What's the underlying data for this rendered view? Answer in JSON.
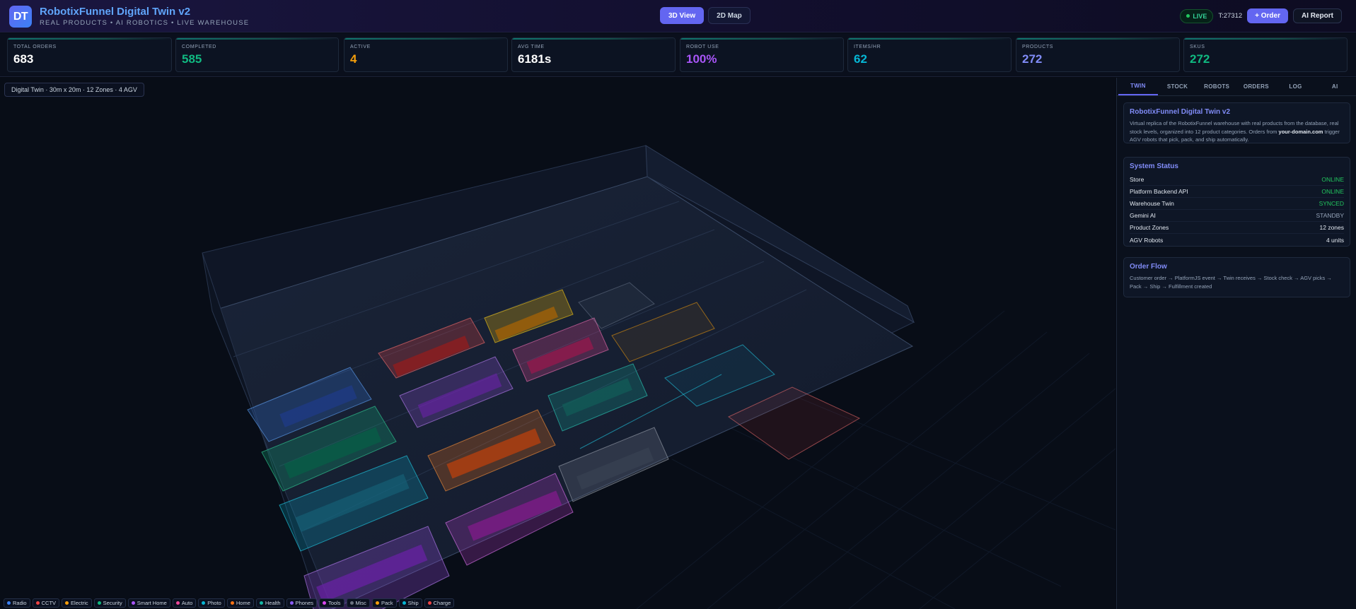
{
  "header": {
    "logo_text": "DT",
    "title": "RobotixFunnel Digital Twin v2",
    "subtitle": "REAL PRODUCTS • AI ROBOTICS • LIVE WAREHOUSE",
    "views": [
      {
        "label": "3D View",
        "active": true
      },
      {
        "label": "2D Map",
        "active": false
      }
    ],
    "live_label": "LIVE",
    "tick": "T:27312",
    "order_button": "+ Order",
    "report_button": "AI Report"
  },
  "stats": [
    {
      "label": "TOTAL ORDERS",
      "value": "683",
      "color": "#ffffff"
    },
    {
      "label": "COMPLETED",
      "value": "585",
      "color": "#10b981"
    },
    {
      "label": "ACTIVE",
      "value": "4",
      "color": "#f59e0b"
    },
    {
      "label": "AVG TIME",
      "value": "6181s",
      "color": "#ffffff"
    },
    {
      "label": "ROBOT USE",
      "value": "100%",
      "color": "#a855f7"
    },
    {
      "label": "ITEMS/HR",
      "value": "62",
      "color": "#06b6d4"
    },
    {
      "label": "PRODUCTS",
      "value": "272",
      "color": "#818cf8"
    },
    {
      "label": "SKUS",
      "value": "272",
      "color": "#10b981"
    }
  ],
  "scene": {
    "label": "Digital Twin · 30m x 20m · 12 Zones · 4 AGV"
  },
  "legend": [
    {
      "label": "Radio",
      "color": "#3b82f6"
    },
    {
      "label": "CCTV",
      "color": "#ef4444"
    },
    {
      "label": "Electric",
      "color": "#f59e0b"
    },
    {
      "label": "Security",
      "color": "#10b981"
    },
    {
      "label": "Smart Home",
      "color": "#a855f7"
    },
    {
      "label": "Auto",
      "color": "#ec4899"
    },
    {
      "label": "Photo",
      "color": "#06b6d4"
    },
    {
      "label": "Home",
      "color": "#f97316"
    },
    {
      "label": "Health",
      "color": "#14b8a6"
    },
    {
      "label": "Phones",
      "color": "#8b5cf6"
    },
    {
      "label": "Tools",
      "color": "#d946ef"
    },
    {
      "label": "Misc",
      "color": "#6b7280"
    },
    {
      "label": "Pack",
      "color": "#f59e0b"
    },
    {
      "label": "Ship",
      "color": "#06b6d4"
    },
    {
      "label": "Charge",
      "color": "#ef4444"
    }
  ],
  "panel": {
    "tabs": [
      {
        "label": "TWIN",
        "active": true
      },
      {
        "label": "STOCK",
        "active": false
      },
      {
        "label": "ROBOTS",
        "active": false
      },
      {
        "label": "ORDERS",
        "active": false
      },
      {
        "label": "LOG",
        "active": false
      },
      {
        "label": "AI",
        "active": false
      }
    ],
    "about": {
      "title": "RobotixFunnel Digital Twin v2",
      "text_before": "Virtual replica of the RobotixFunnel warehouse with real products from the database, real stock levels, organized into 12 product categories. Orders from ",
      "text_bold": "your-domain.com",
      "text_after": " trigger AGV robots that pick, pack, and ship automatically."
    },
    "status": {
      "title": "System Status",
      "rows": [
        {
          "key": "Store",
          "value": "ONLINE",
          "tone": "ok"
        },
        {
          "key": "Platform Backend API",
          "value": "ONLINE",
          "tone": "ok"
        },
        {
          "key": "Warehouse Twin",
          "value": "SYNCED",
          "tone": "ok"
        },
        {
          "key": "Gemini AI",
          "value": "STANDBY",
          "tone": "mid"
        },
        {
          "key": "Product Zones",
          "value": "12 zones",
          "tone": "plain"
        },
        {
          "key": "AGV Robots",
          "value": "4 units",
          "tone": "plain"
        }
      ]
    },
    "flow": {
      "title": "Order Flow",
      "text": "Customer order → PlatformJS event → Twin receives → Stock check → AGV picks → Pack → Ship → Fulfillment created"
    }
  }
}
